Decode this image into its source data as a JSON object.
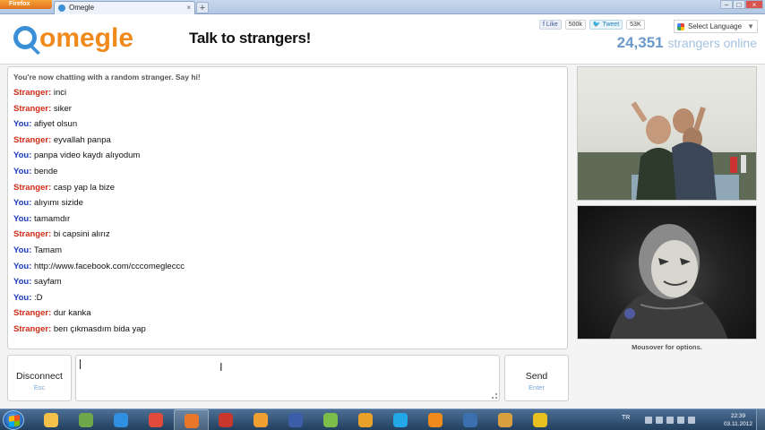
{
  "browser": {
    "app_button": "Firefox",
    "tab_title": "Omegle",
    "tab_close": "×",
    "new_tab": "+",
    "min": "–",
    "max": "□",
    "close": "×"
  },
  "header": {
    "logo_text": "omegle",
    "tagline": "Talk to strangers!",
    "like_label": "Like",
    "like_count": "500k",
    "tweet_label": "Tweet",
    "tweet_count": "53K",
    "language_label": "Select Language",
    "online_count": "24,351",
    "online_label": "strangers online"
  },
  "chat": {
    "system_message": "You're now chatting with a random stranger. Say hi!",
    "messages": [
      {
        "who": "Stranger:",
        "type": "stranger",
        "text": "inci"
      },
      {
        "who": "Stranger:",
        "type": "stranger",
        "text": "siker"
      },
      {
        "who": "You:",
        "type": "you",
        "text": "afiyet olsun"
      },
      {
        "who": "Stranger:",
        "type": "stranger",
        "text": "eyvallah panpa"
      },
      {
        "who": "You:",
        "type": "you",
        "text": "panpa video kaydı alıyodum"
      },
      {
        "who": "You:",
        "type": "you",
        "text": "bende"
      },
      {
        "who": "Stranger:",
        "type": "stranger",
        "text": "casp yap la bize"
      },
      {
        "who": "You:",
        "type": "you",
        "text": "alıyımı sizide"
      },
      {
        "who": "You:",
        "type": "you",
        "text": "tamamdır"
      },
      {
        "who": "Stranger:",
        "type": "stranger",
        "text": "bi capsini alırız"
      },
      {
        "who": "You:",
        "type": "you",
        "text": "Tamam"
      },
      {
        "who": "You:",
        "type": "you",
        "text": "http://www.facebook.com/cccomegleccc"
      },
      {
        "who": "You:",
        "type": "you",
        "text": "sayfam"
      },
      {
        "who": "You:",
        "type": "you",
        "text": ":D"
      },
      {
        "who": "Stranger:",
        "type": "stranger",
        "text": "dur kanka"
      },
      {
        "who": "Stranger:",
        "type": "stranger",
        "text": "ben çıkmasdım bida yap"
      }
    ]
  },
  "video": {
    "mouseover_hint": "Mousover for options."
  },
  "controls": {
    "disconnect_label": "Disconnect",
    "disconnect_key": "Esc",
    "send_label": "Send",
    "send_key": "Enter",
    "input_value": ""
  },
  "taskbar": {
    "language": "TR",
    "time": "22:39",
    "date": "03.11.2012",
    "icons": [
      "explorer-icon",
      "network-icon",
      "internet-explorer-icon",
      "chrome-icon",
      "firefox-icon",
      "media-icon",
      "orange-ball-icon",
      "tool-icon",
      "picasa-icon",
      "winamp-icon",
      "skype-icon",
      "vlc-icon",
      "film-icon",
      "counter-strike-icon",
      "norton-icon"
    ]
  },
  "colors": {
    "stranger": "#d02c16",
    "you": "#1a3ac0",
    "online": "#6a9acb",
    "logo_blue": "#3a8fd6",
    "logo_orange": "#f08a1c"
  }
}
